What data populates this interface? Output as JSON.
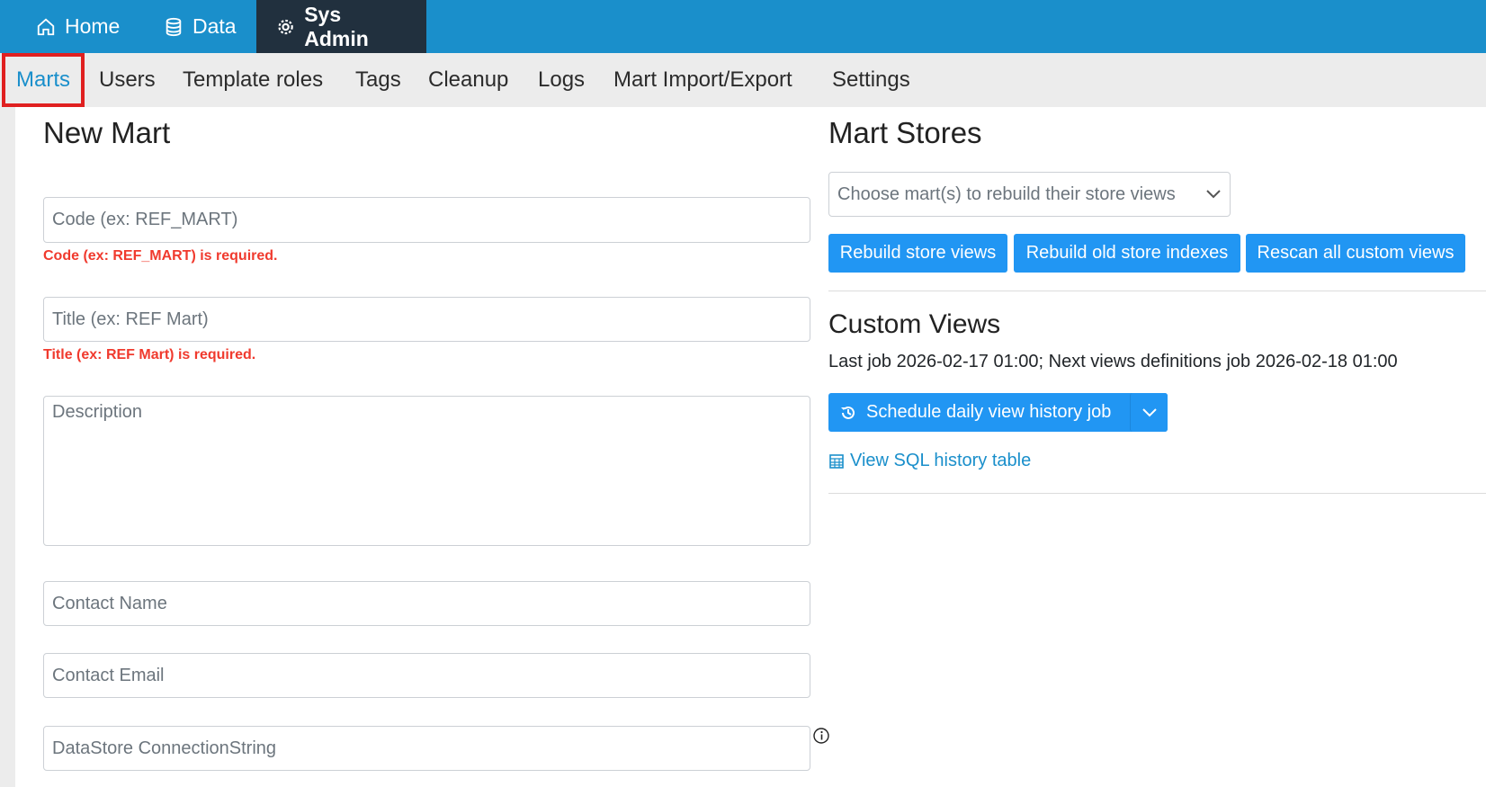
{
  "topnav": {
    "home": "Home",
    "data": "Data",
    "sysadmin": "Sys Admin"
  },
  "subnav": [
    "Marts",
    "Users",
    "Template roles",
    "Tags",
    "Cleanup",
    "Logs",
    "Mart Import/Export",
    "Settings"
  ],
  "new_mart": {
    "title": "New Mart",
    "code_placeholder": "Code (ex: REF_MART)",
    "code_error": "Code (ex: REF_MART) is required.",
    "title_placeholder": "Title (ex: REF Mart)",
    "title_error": "Title (ex: REF Mart) is required.",
    "description_placeholder": "Description",
    "contact_name_placeholder": "Contact Name",
    "contact_email_placeholder": "Contact Email",
    "connection_placeholder": "DataStore ConnectionString"
  },
  "mart_stores": {
    "title": "Mart Stores",
    "select_placeholder": "Choose mart(s) to rebuild their store views",
    "buttons": [
      "Rebuild store views",
      "Rebuild old store indexes",
      "Rescan all custom views"
    ]
  },
  "custom_views": {
    "title": "Custom Views",
    "status": "Last job 2026-02-17 01:00; Next views definitions job 2026-02-18 01:00",
    "schedule_button": "Schedule daily view history job",
    "sql_link": "View SQL history table"
  }
}
